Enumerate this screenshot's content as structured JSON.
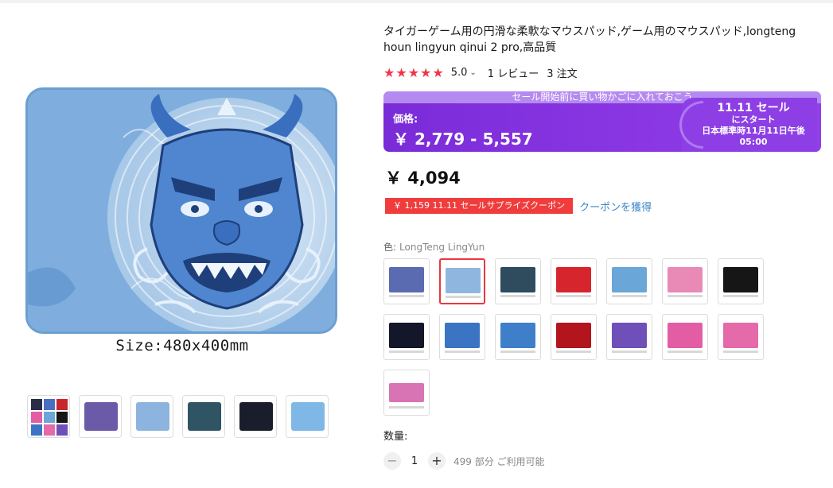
{
  "product": {
    "title": "タイガーゲーム用の円滑な柔軟なマウスパッド,ゲーム用のマウスパッド,longteng houn lingyun qinui 2 pro,高品質",
    "image_caption": "Size:480x400mm"
  },
  "rating": {
    "stars": "★★★★★",
    "value": "5.0",
    "caret": "⌄",
    "reviews": "1 レビュー",
    "orders": "3 注文"
  },
  "promo": {
    "strip_text": "セール開始前に買い物かごに入れておこう",
    "price_label": "価格:",
    "price_range": "￥ 2,779 - 5,557",
    "badge_line1": "11.11 セール",
    "badge_line2": "にスタート",
    "badge_line3": "日本標準時11月11日午後",
    "badge_line4": "05:00"
  },
  "price": "￥ 4,094",
  "coupon": {
    "tag": "￥ 1,159 11.11 セールサプライズクーポン",
    "link": "クーポンを獲得"
  },
  "color": {
    "label": "色:",
    "selected": "LongTeng LingYun",
    "swatch_colors": [
      "#5b6bb2",
      "#8fb6de",
      "#2e4c5e",
      "#d6252d",
      "#6aa6d8",
      "#e98ab6",
      "#161616",
      "#14162a",
      "#3b74c2",
      "#3f7fc9",
      "#b3151d",
      "#6f4fb8",
      "#e35da4",
      "#e46aa9",
      "#d874b4"
    ]
  },
  "gallery": {
    "thumb_colors": [
      "#7a8fc8",
      "#6a5aa8",
      "#8cb4de",
      "#2f5564",
      "#1a1d2c",
      "#7fb8e6"
    ]
  },
  "quantity": {
    "label": "数量:",
    "minus": "−",
    "value": "1",
    "plus": "+",
    "available": "499 部分 ご利用可能"
  }
}
